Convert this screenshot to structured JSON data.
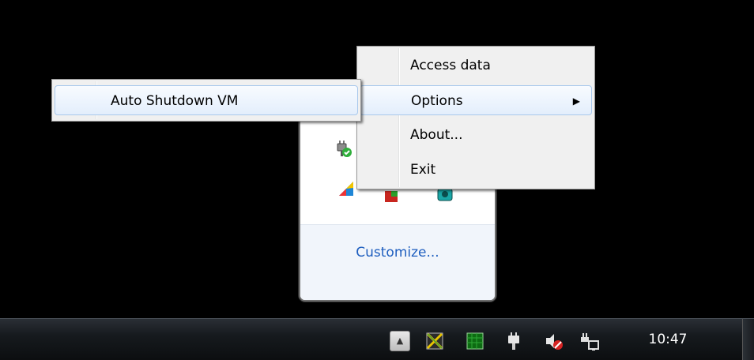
{
  "flyout": {
    "customize_label": "Customize...",
    "icons": [
      "usb-safely-remove-icon",
      "colorful-app-icon",
      "shield-app-icon",
      "network-app-icon"
    ]
  },
  "context_menu": {
    "items": [
      {
        "label": "Access data"
      },
      {
        "label": "Options",
        "has_submenu": true
      },
      {
        "label": "About..."
      },
      {
        "label": "Exit"
      }
    ]
  },
  "submenu": {
    "items": [
      {
        "label": "Auto Shutdown VM"
      }
    ]
  },
  "taskbar": {
    "clock_time": "10:47",
    "tray_icons": [
      "virtualbox-icon",
      "green-grid-icon",
      "usb-device-icon",
      "volume-muted-icon",
      "network-icon"
    ]
  }
}
